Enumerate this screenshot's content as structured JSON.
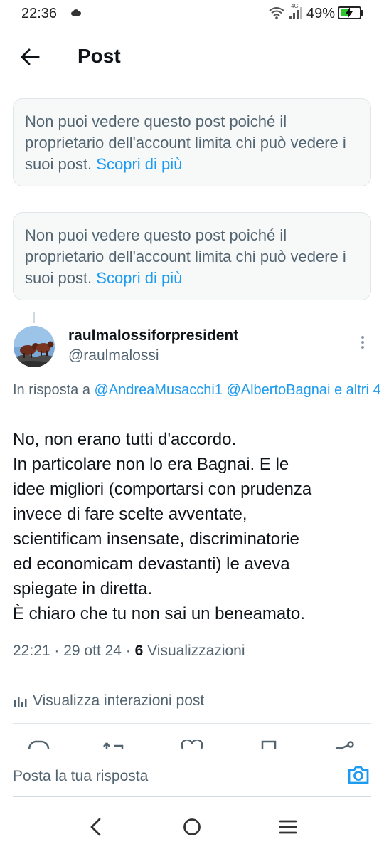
{
  "status_bar": {
    "time": "22:36",
    "network": "4G",
    "battery_percent": "49%",
    "battery_level": 0.49
  },
  "header": {
    "title": "Post"
  },
  "notices": [
    {
      "text": "Non puoi vedere questo post poiché il proprietario dell'account limita chi può vedere i suoi post.",
      "link": "Scopri di più"
    },
    {
      "text": "Non puoi vedere questo post poiché il proprietario dell'account limita chi può vedere i suoi post.",
      "link": "Scopri di più"
    }
  ],
  "post": {
    "display_name": "raulmalossiforpresident",
    "handle": "@raulmalossi",
    "reply_prefix": "In risposta a ",
    "mention_1": "@AndreaMusacchi1",
    "mention_2": "@AlbertoBagnai",
    "mention_more": "e altri 4",
    "lines": [
      "No, non erano tutti d'accordo.",
      "In particolare non lo era Bagnai. E le",
      "idee migliori (comportarsi con prudenza",
      "invece di fare scelte avventate,",
      "scientificam insensate, discriminatorie",
      "ed economicam devastanti) le aveva",
      "spiegate in diretta.",
      "È chiaro che tu non sai un beneamato."
    ],
    "time": "22:21",
    "date": "29 ott 24",
    "views_count": "6",
    "views_label": "Visualizzazioni",
    "interactions_label": "Visualizza interazioni post"
  },
  "composer": {
    "placeholder": "Posta la tua risposta"
  },
  "icons": {
    "back": "arrow-left-icon",
    "more": "more-vertical-icon",
    "analytics": "bar-chart-icon",
    "reply": "reply-icon",
    "repost": "repost-icon",
    "like": "heart-icon",
    "bookmark": "bookmark-icon",
    "share": "share-icon",
    "camera": "camera-icon"
  },
  "colors": {
    "accent": "#1d9bf0",
    "text_primary": "#0f1419",
    "text_secondary": "#536471",
    "battery": "#2ec82e"
  }
}
